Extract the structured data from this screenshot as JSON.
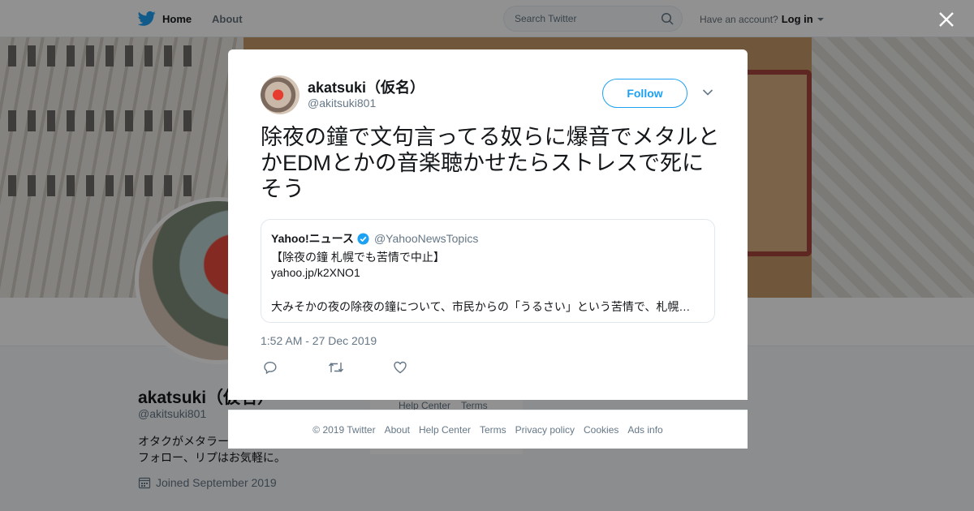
{
  "topbar": {
    "home_label": "Home",
    "about_label": "About",
    "search_placeholder": "Search Twitter",
    "account_prompt": "Have an account?",
    "login_label": "Log in"
  },
  "background_profile": {
    "name": "akatsuki（仮名）",
    "handle": "@akitsuki801",
    "bio_line1": "オタクがメタラー",
    "bio_line2": "フォロー、リプはお気軽に。",
    "joined": "Joined September 2019",
    "footer_links": [
      "Help Center",
      "Terms"
    ]
  },
  "tweet": {
    "author_name": "akatsuki（仮名）",
    "author_handle": "@akitsuki801",
    "follow_label": "Follow",
    "text": "除夜の鐘で文句言ってる奴らに爆音でメタルとかEDMとかの音楽聴かせたらストレスで死にそう",
    "timestamp": "1:52 AM - 27 Dec 2019",
    "quoted": {
      "name": "Yahoo!ニュース",
      "handle": "@YahooNewsTopics",
      "line1": "【除夜の鐘 札幌でも苦情で中止】",
      "line2": "yahoo.jp/k2XNO1",
      "line3": "大みそかの夜の除夜の鐘について、市民からの「うるさい」という苦情で、札幌…"
    }
  },
  "modal_footer": {
    "links": [
      "© 2019 Twitter",
      "About",
      "Help Center",
      "Terms",
      "Privacy policy",
      "Cookies",
      "Ads info"
    ]
  },
  "colors": {
    "accent": "#1da1f2",
    "secondary_text": "#657786",
    "overlay": "rgba(0,0,0,0.43)"
  },
  "icons": [
    "twitter-bird-icon",
    "search-icon",
    "close-icon",
    "chevron-down-icon",
    "verified-badge-icon",
    "reply-icon",
    "retweet-icon",
    "like-icon",
    "calendar-icon"
  ]
}
